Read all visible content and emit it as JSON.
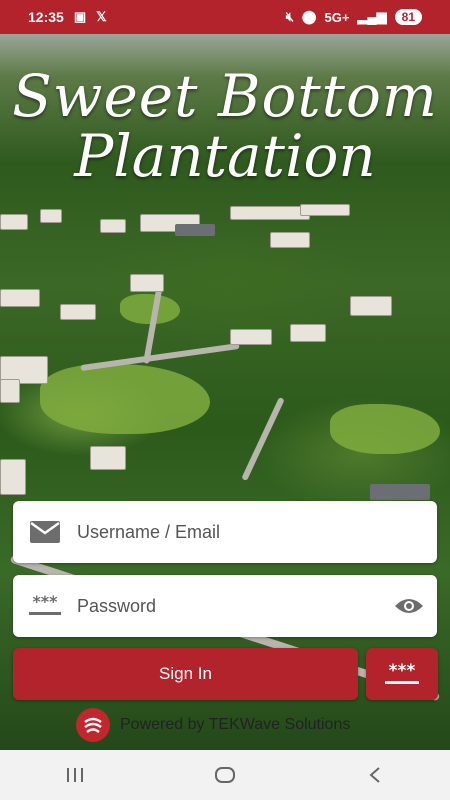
{
  "status_bar": {
    "time": "12:35",
    "network": "5G+",
    "battery": "81"
  },
  "app": {
    "title_line1": "Sweet Bottom",
    "title_line2": "Plantation"
  },
  "form": {
    "username_placeholder": "Username / Email",
    "password_placeholder": "Password",
    "password_icon_text": "***",
    "signin_label": "Sign In",
    "pin_label": "***"
  },
  "footer": {
    "powered_by": "Powered by TEKWave Solutions"
  },
  "colors": {
    "brand_red": "#b3232b",
    "field_bg": "#ffffff"
  },
  "icons": [
    "mail-icon",
    "password-dots-icon",
    "eye-icon",
    "pin-keypad-icon",
    "tekwave-logo",
    "recents-icon",
    "home-icon",
    "back-icon"
  ]
}
